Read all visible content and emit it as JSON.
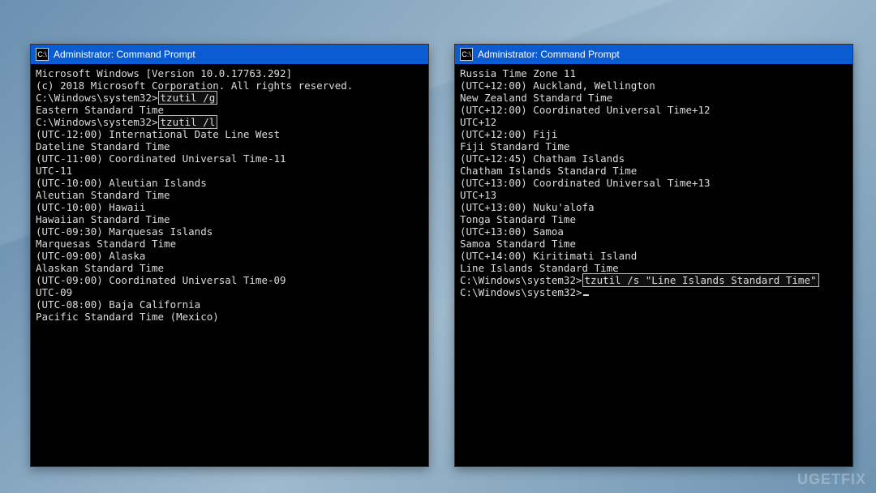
{
  "watermark": "UGETFIX",
  "titlebar_text": "Administrator: Command Prompt",
  "left_console": [
    {
      "text": "Microsoft Windows [Version 10.0.17763.292]"
    },
    {
      "text": "(c) 2018 Microsoft Corporation. All rights reserved."
    },
    {
      "text": ""
    },
    {
      "prefix": "C:\\Windows\\system32>",
      "highlight": "tzutil /g"
    },
    {
      "text": "Eastern Standard Time"
    },
    {
      "prefix": "C:\\Windows\\system32>",
      "highlight": "tzutil /l"
    },
    {
      "text": "(UTC-12:00) International Date Line West"
    },
    {
      "text": "Dateline Standard Time"
    },
    {
      "text": ""
    },
    {
      "text": "(UTC-11:00) Coordinated Universal Time-11"
    },
    {
      "text": "UTC-11"
    },
    {
      "text": ""
    },
    {
      "text": "(UTC-10:00) Aleutian Islands"
    },
    {
      "text": "Aleutian Standard Time"
    },
    {
      "text": ""
    },
    {
      "text": "(UTC-10:00) Hawaii"
    },
    {
      "text": "Hawaiian Standard Time"
    },
    {
      "text": ""
    },
    {
      "text": "(UTC-09:30) Marquesas Islands"
    },
    {
      "text": "Marquesas Standard Time"
    },
    {
      "text": ""
    },
    {
      "text": "(UTC-09:00) Alaska"
    },
    {
      "text": "Alaskan Standard Time"
    },
    {
      "text": ""
    },
    {
      "text": "(UTC-09:00) Coordinated Universal Time-09"
    },
    {
      "text": "UTC-09"
    },
    {
      "text": ""
    },
    {
      "text": "(UTC-08:00) Baja California"
    },
    {
      "text": "Pacific Standard Time (Mexico)"
    }
  ],
  "right_console": [
    {
      "text": "Russia Time Zone 11"
    },
    {
      "text": ""
    },
    {
      "text": "(UTC+12:00) Auckland, Wellington"
    },
    {
      "text": "New Zealand Standard Time"
    },
    {
      "text": ""
    },
    {
      "text": "(UTC+12:00) Coordinated Universal Time+12"
    },
    {
      "text": "UTC+12"
    },
    {
      "text": ""
    },
    {
      "text": "(UTC+12:00) Fiji"
    },
    {
      "text": "Fiji Standard Time"
    },
    {
      "text": ""
    },
    {
      "text": "(UTC+12:45) Chatham Islands"
    },
    {
      "text": "Chatham Islands Standard Time"
    },
    {
      "text": ""
    },
    {
      "text": "(UTC+13:00) Coordinated Universal Time+13"
    },
    {
      "text": "UTC+13"
    },
    {
      "text": ""
    },
    {
      "text": "(UTC+13:00) Nuku'alofa"
    },
    {
      "text": "Tonga Standard Time"
    },
    {
      "text": ""
    },
    {
      "text": "(UTC+13:00) Samoa"
    },
    {
      "text": "Samoa Standard Time"
    },
    {
      "text": ""
    },
    {
      "text": "(UTC+14:00) Kiritimati Island"
    },
    {
      "text": "Line Islands Standard Time"
    },
    {
      "text": ""
    },
    {
      "text": ""
    },
    {
      "prefix": "C:\\Windows\\system32>",
      "highlight": "tzutil /s \"Line Islands Standard Time\""
    },
    {
      "text": ""
    },
    {
      "prefix": "C:\\Windows\\system32>",
      "cursor": true
    }
  ]
}
